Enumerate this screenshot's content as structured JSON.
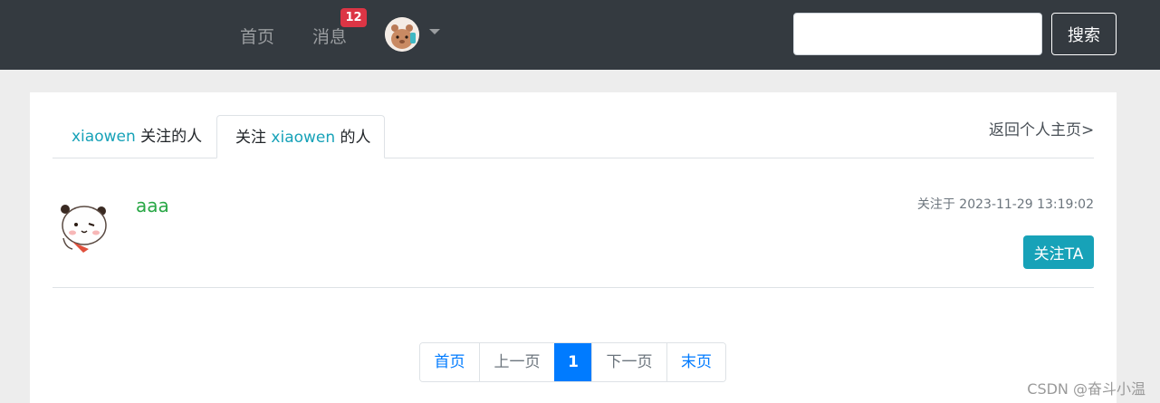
{
  "navbar": {
    "home_label": "首页",
    "messages_label": "消息",
    "messages_badge": "12",
    "search": {
      "value": "",
      "placeholder": ""
    },
    "search_button": "搜索"
  },
  "tabs": [
    {
      "user": "xiaowen",
      "suffix": " 关注的人"
    },
    {
      "prefix": "关注 ",
      "user": "xiaowen",
      "suffix": " 的人"
    }
  ],
  "back_link": "返回个人主页>",
  "followers": [
    {
      "username": "aaa",
      "time_text": "关注于 2023-11-29 13:19:02",
      "action_label": "关注TA"
    }
  ],
  "pagination": {
    "first": "首页",
    "prev": "上一页",
    "current": "1",
    "next": "下一页",
    "last": "末页"
  },
  "watermark": "CSDN @奋斗小温",
  "colors": {
    "teal": "#17a2b8",
    "green": "#28a745",
    "blue": "#007bff",
    "badge_red": "#dc3545",
    "navbar": "#343a40"
  }
}
